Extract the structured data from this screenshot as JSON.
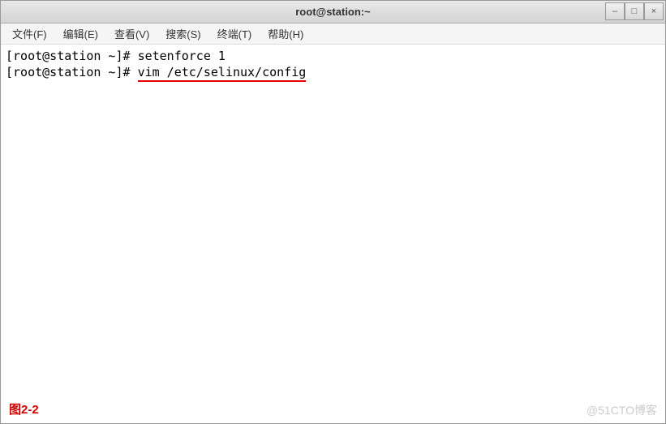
{
  "window": {
    "title": "root@station:~",
    "controls": {
      "minimize": "–",
      "maximize": "□",
      "close": "×"
    }
  },
  "menubar": {
    "items": [
      {
        "label": "文件(F)"
      },
      {
        "label": "编辑(E)"
      },
      {
        "label": "查看(V)"
      },
      {
        "label": "搜索(S)"
      },
      {
        "label": "终端(T)"
      },
      {
        "label": "帮助(H)"
      }
    ]
  },
  "terminal": {
    "lines": [
      {
        "prompt": "[root@station ~]# ",
        "command": "setenforce 1",
        "highlighted": false
      },
      {
        "prompt": "[root@station ~]# ",
        "command": "vim /etc/selinux/config",
        "highlighted": true
      }
    ]
  },
  "caption": "图2-2",
  "watermark": "@51CTO博客"
}
